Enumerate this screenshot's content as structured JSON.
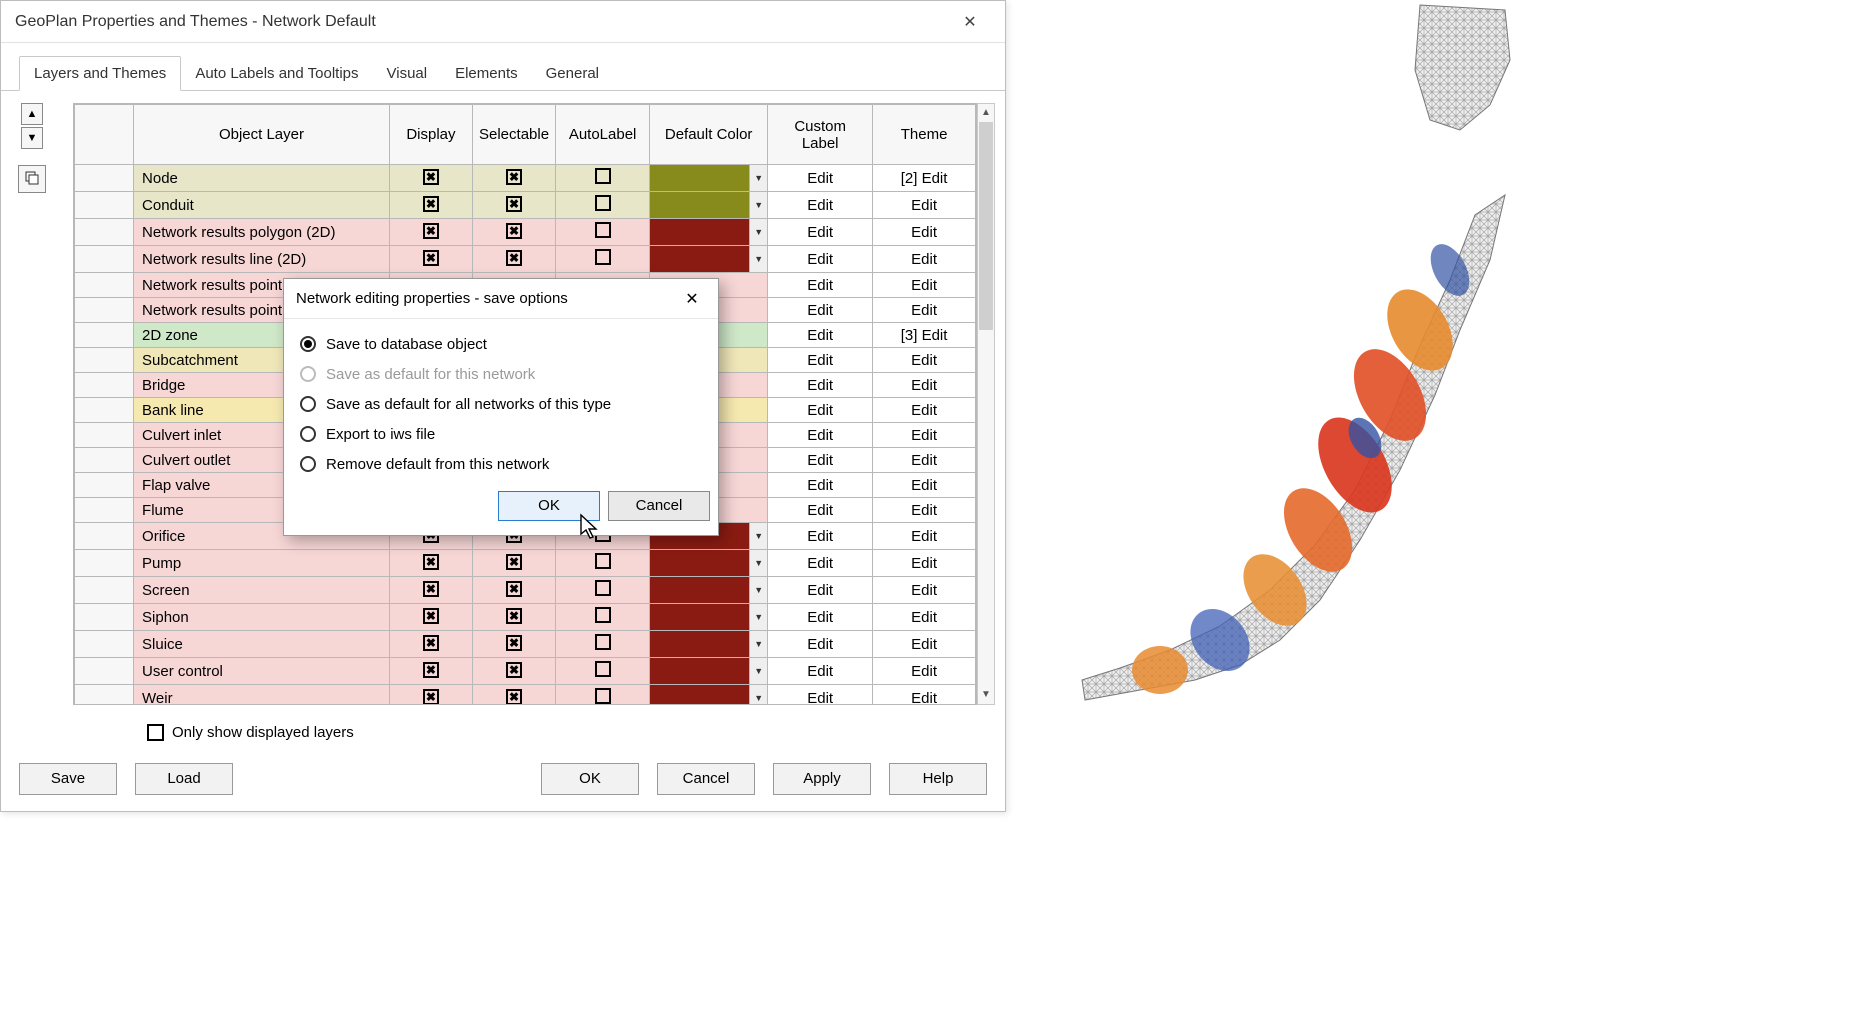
{
  "window": {
    "title": "GeoPlan Properties and Themes - Network Default"
  },
  "tabs": [
    {
      "label": "Layers and Themes",
      "active": true
    },
    {
      "label": "Auto Labels and Tooltips",
      "active": false
    },
    {
      "label": "Visual",
      "active": false
    },
    {
      "label": "Elements",
      "active": false
    },
    {
      "label": "General",
      "active": false
    }
  ],
  "columns": {
    "object_layer": "Object Layer",
    "display": "Display",
    "selectable": "Selectable",
    "autolabel": "AutoLabel",
    "default_color": "Default Color",
    "custom_label": "Custom Label",
    "theme": "Theme"
  },
  "rows": [
    {
      "name": "Node",
      "cls": "r-node",
      "disp": true,
      "sel": true,
      "auto": false,
      "color": "#878b1b",
      "custom": "Edit",
      "theme": "[2] Edit"
    },
    {
      "name": "Conduit",
      "cls": "r-node",
      "disp": true,
      "sel": true,
      "auto": false,
      "color": "#878b1b",
      "custom": "Edit",
      "theme": "Edit"
    },
    {
      "name": "Network results polygon (2D)",
      "cls": "r-pink",
      "disp": true,
      "sel": true,
      "auto": false,
      "color": "#8a1b12",
      "custom": "Edit",
      "theme": "Edit"
    },
    {
      "name": "Network results line (2D)",
      "cls": "r-pink",
      "disp": true,
      "sel": true,
      "auto": false,
      "color": "#8a1b12",
      "custom": "Edit",
      "theme": "Edit"
    },
    {
      "name": "Network results point",
      "cls": "r-pink",
      "disp": null,
      "sel": null,
      "auto": null,
      "color": null,
      "custom": "Edit",
      "theme": "Edit"
    },
    {
      "name": "Network results point",
      "cls": "r-pink",
      "disp": null,
      "sel": null,
      "auto": null,
      "color": null,
      "custom": "Edit",
      "theme": "Edit"
    },
    {
      "name": "2D zone",
      "cls": "r-zone",
      "disp": null,
      "sel": null,
      "auto": null,
      "color": null,
      "custom": "Edit",
      "theme": "[3] Edit"
    },
    {
      "name": "Subcatchment",
      "cls": "r-sub",
      "disp": null,
      "sel": null,
      "auto": null,
      "color": null,
      "custom": "Edit",
      "theme": "Edit"
    },
    {
      "name": "Bridge",
      "cls": "r-pink",
      "disp": null,
      "sel": null,
      "auto": null,
      "color": null,
      "custom": "Edit",
      "theme": "Edit"
    },
    {
      "name": "Bank line",
      "cls": "r-bank",
      "disp": null,
      "sel": null,
      "auto": null,
      "color": null,
      "custom": "Edit",
      "theme": "Edit"
    },
    {
      "name": "Culvert inlet",
      "cls": "r-pink",
      "disp": null,
      "sel": null,
      "auto": null,
      "color": null,
      "custom": "Edit",
      "theme": "Edit"
    },
    {
      "name": "Culvert outlet",
      "cls": "r-pink",
      "disp": null,
      "sel": null,
      "auto": null,
      "color": null,
      "custom": "Edit",
      "theme": "Edit"
    },
    {
      "name": "Flap valve",
      "cls": "r-pink",
      "disp": null,
      "sel": null,
      "auto": null,
      "color": null,
      "custom": "Edit",
      "theme": "Edit"
    },
    {
      "name": "Flume",
      "cls": "r-pink",
      "disp": null,
      "sel": null,
      "auto": null,
      "color": null,
      "custom": "Edit",
      "theme": "Edit"
    },
    {
      "name": "Orifice",
      "cls": "r-pink",
      "disp": true,
      "sel": true,
      "auto": false,
      "color": "#8a1b12",
      "custom": "Edit",
      "theme": "Edit"
    },
    {
      "name": "Pump",
      "cls": "r-pink",
      "disp": true,
      "sel": true,
      "auto": false,
      "color": "#8a1b12",
      "custom": "Edit",
      "theme": "Edit"
    },
    {
      "name": "Screen",
      "cls": "r-pink",
      "disp": true,
      "sel": true,
      "auto": false,
      "color": "#8a1b12",
      "custom": "Edit",
      "theme": "Edit"
    },
    {
      "name": "Siphon",
      "cls": "r-pink",
      "disp": true,
      "sel": true,
      "auto": false,
      "color": "#8a1b12",
      "custom": "Edit",
      "theme": "Edit"
    },
    {
      "name": "Sluice",
      "cls": "r-pink",
      "disp": true,
      "sel": true,
      "auto": false,
      "color": "#8a1b12",
      "custom": "Edit",
      "theme": "Edit"
    },
    {
      "name": "User control",
      "cls": "r-pink",
      "disp": true,
      "sel": true,
      "auto": false,
      "color": "#8a1b12",
      "custom": "Edit",
      "theme": "Edit"
    },
    {
      "name": "Weir",
      "cls": "r-pink",
      "disp": true,
      "sel": true,
      "auto": false,
      "color": "#8a1b12",
      "custom": "Edit",
      "theme": "Edit"
    }
  ],
  "options": {
    "only_show_displayed": "Only show displayed layers"
  },
  "bottom_buttons": {
    "save": "Save",
    "load": "Load",
    "ok": "OK",
    "cancel": "Cancel",
    "apply": "Apply",
    "help": "Help"
  },
  "modal": {
    "title": "Network editing properties - save options",
    "options": [
      {
        "label": "Save to database object",
        "selected": true,
        "enabled": true
      },
      {
        "label": "Save as default for this network",
        "selected": false,
        "enabled": false
      },
      {
        "label": "Save as default for all networks of this type",
        "selected": false,
        "enabled": true
      },
      {
        "label": "Export to iws file",
        "selected": false,
        "enabled": true
      },
      {
        "label": "Remove default from this network",
        "selected": false,
        "enabled": true
      }
    ],
    "ok": "OK",
    "cancel": "Cancel"
  }
}
